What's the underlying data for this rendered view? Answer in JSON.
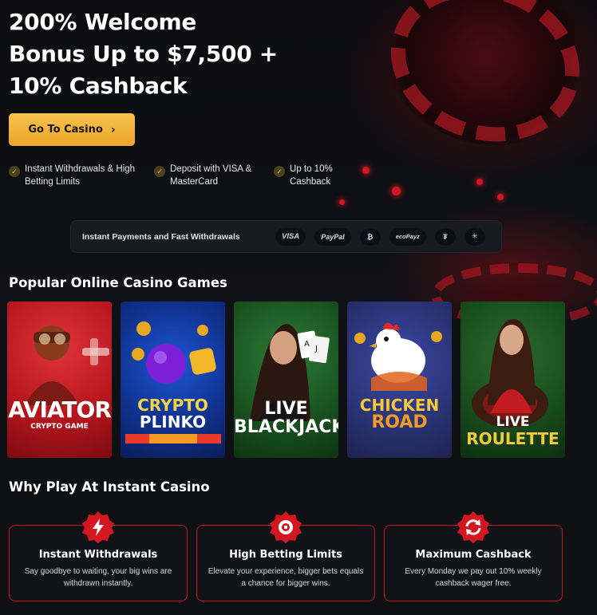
{
  "hero": {
    "title_lines": [
      "200% Welcome",
      "Bonus Up to $7,500 +",
      "10% Cashback"
    ],
    "cta_label": "Go To Casino",
    "features": [
      {
        "text": "Instant Withdrawals & High Betting Limits"
      },
      {
        "text": "Deposit with VISA & MasterCard"
      },
      {
        "text": "Up to 10% Cashback"
      }
    ]
  },
  "payments": {
    "label": "Instant Payments and Fast Withdrawals",
    "methods": [
      "VISA",
      "PayPal",
      "₿",
      "ecoPayz",
      "₮",
      "✳"
    ]
  },
  "games": {
    "title": "Popular Online Casino Games",
    "items": [
      {
        "line1": "AVIATOR",
        "line2": "CRYPTO GAME"
      },
      {
        "line1": "CRYPTO",
        "line2": "PLINKO"
      },
      {
        "line1": "LIVE",
        "line2": "BLACKJACK"
      },
      {
        "line1": "CHICKEN",
        "line2": "ROAD"
      },
      {
        "line1": "LIVE",
        "line2": "ROULETTE"
      }
    ]
  },
  "why": {
    "title": "Why Play At Instant Casino",
    "cards": [
      {
        "title": "Instant Withdrawals",
        "desc": "Say goodbye to waiting, your big wins are withdrawn instantly."
      },
      {
        "title": "High Betting Limits",
        "desc": "Elevate your experience, bigger bets equals a chance for bigger wins."
      },
      {
        "title": "Maximum Cashback",
        "desc": "Every Monday we pay out 10% weekly cashback wager free."
      }
    ]
  },
  "colors": {
    "accent_gold": "#f2b33a",
    "accent_red": "#c3161f",
    "background": "#0f1014"
  }
}
